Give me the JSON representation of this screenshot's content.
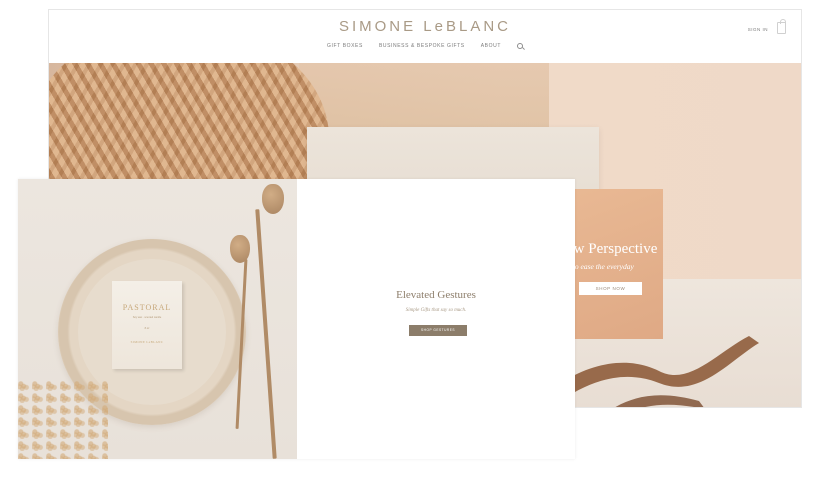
{
  "back_page": {
    "brand": "SIMONE LeBLANC",
    "nav": [
      "GIFT BOXES",
      "BUSINESS & BESPOKE GIFTS",
      "ABOUT"
    ],
    "nav_search_icon": "search-icon",
    "sign_in": "SIGN IN",
    "bag_icon": "shopping-bag-icon",
    "hero": {
      "headline": "ew Perspective",
      "subtext": "s to ease the everyday",
      "button": "SHOP NOW"
    }
  },
  "front_page": {
    "product_box": {
      "brand": "PASTORAL",
      "detail": "Soy wax · scented candle",
      "weight": "8 oz",
      "maker": "SIMONE LeBLANC"
    },
    "promo": {
      "title": "Elevated Gestures",
      "subtitle": "Simple Gifts that say so much.",
      "button": "SHOP GESTURES"
    }
  },
  "colors": {
    "brand_text": "#a99a86",
    "promo_button": "#8c7d6a",
    "hero_peach": "#e9b994"
  }
}
